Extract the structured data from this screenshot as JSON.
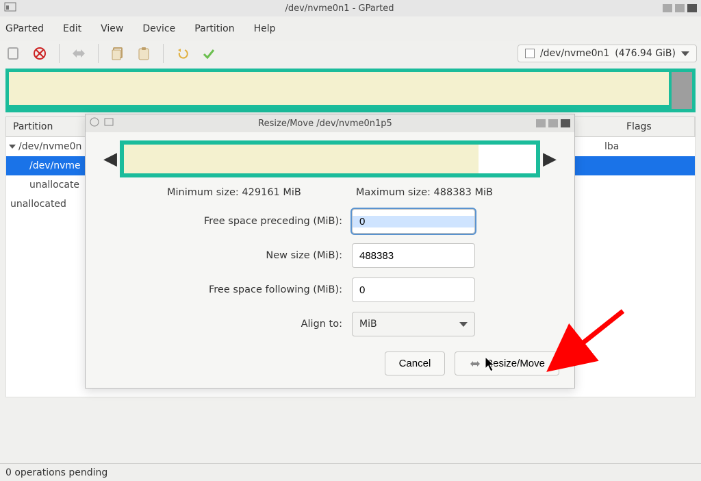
{
  "window": {
    "title": "/dev/nvme0n1 - GParted"
  },
  "menubar": [
    "GParted",
    "Edit",
    "View",
    "Device",
    "Partition",
    "Help"
  ],
  "device_selector": {
    "name": "/dev/nvme0n1",
    "size": "(476.94 GiB)"
  },
  "table": {
    "headers": {
      "partition": "Partition",
      "flags": "Flags"
    },
    "rows": [
      {
        "label": "/dev/nvme0n",
        "flags": "lba",
        "indent": 0,
        "expander": true
      },
      {
        "label": "/dev/nvme",
        "indent": 1,
        "selected": true
      },
      {
        "label": "unallocate",
        "indent": 1
      },
      {
        "label": "unallocated",
        "indent": 0
      }
    ]
  },
  "dialog": {
    "title": "Resize/Move /dev/nvme0n1p5",
    "min_label": "Minimum size: 429161 MiB",
    "max_label": "Maximum size: 488383 MiB",
    "fields": {
      "preceding": {
        "label": "Free space preceding (MiB):",
        "value": "0"
      },
      "newsize": {
        "label": "New size (MiB):",
        "value": "488383"
      },
      "following": {
        "label": "Free space following (MiB):",
        "value": "0"
      },
      "align": {
        "label": "Align to:",
        "value": "MiB"
      }
    },
    "buttons": {
      "cancel": "Cancel",
      "apply": "Resize/Move"
    }
  },
  "statusbar": "0 operations pending"
}
